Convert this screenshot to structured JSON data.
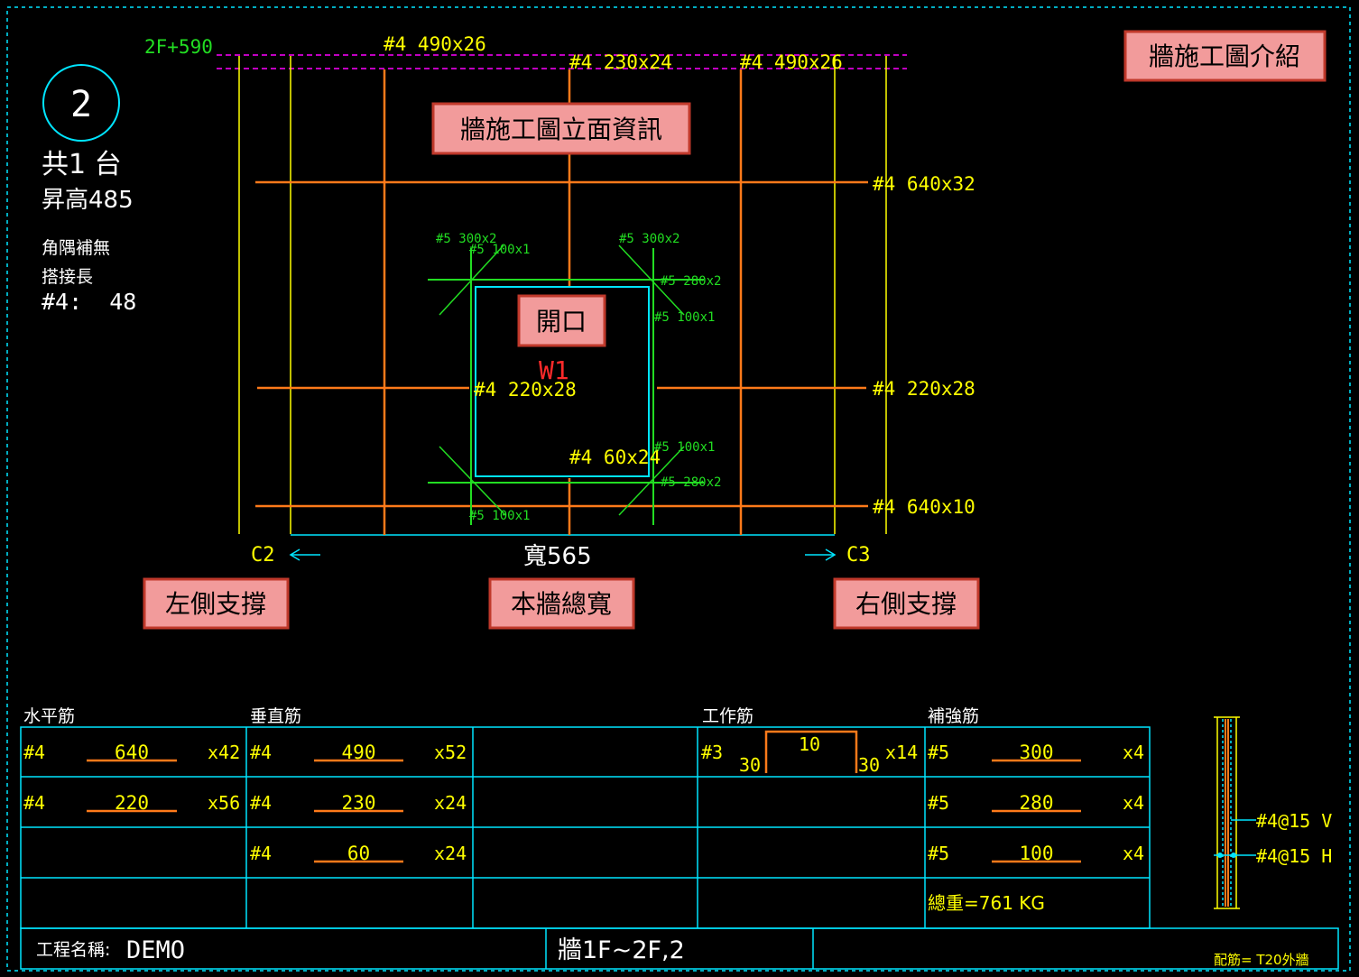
{
  "colors": {
    "background": "#000000",
    "cyan": "#00e5ff",
    "yellow": "#ffff00",
    "orange": "#ff7a1a",
    "green": "#22dd22",
    "magenta": "#ff00ff",
    "red": "#ff2a2a",
    "callout_fill": "#f29b9b",
    "callout_border": "#c0392b"
  },
  "header": {
    "wall_number": "2",
    "count_label": "共1 台",
    "height_label": "昇高485",
    "corner_label": "角隅補無",
    "lap_label": "搭接長",
    "lap_value": "#4:  48"
  },
  "elevation": {
    "level_label": "2F+590",
    "top_bars": [
      "#4 490x26",
      "#4 230x24",
      "#4 490x26"
    ],
    "right_bars": [
      "#4 640x32",
      "#4 220x28",
      "#4 640x10"
    ],
    "inner_bar_mid": "#4 220x28",
    "inner_bar_low": "#4 60x24",
    "opening_name": "W1",
    "reinforcement": {
      "tl_a": "#5 300x2",
      "tl_b": "#5 100x1",
      "tr_a": "#5 300x2",
      "tr_b": "#5 280x2",
      "tr_c": "#5 100x1",
      "br_a": "#5 100x1",
      "br_b": "#5 280x2",
      "bl_a": "#5 100x1"
    },
    "left_support": "C2",
    "right_support": "C3",
    "width_label": "寬565"
  },
  "callouts": {
    "intro": "牆施工圖介紹",
    "elevation_info": "牆施工圖立面資訊",
    "opening": "開口",
    "left_support": "左側支撐",
    "total_width": "本牆總寬",
    "right_support": "右側支撐"
  },
  "table": {
    "section_headers": [
      "水平筋",
      "垂直筋",
      "工作筋",
      "補強筋"
    ],
    "horizontal_rows": [
      {
        "bar": "#4",
        "length": "640",
        "qty": "x42"
      },
      {
        "bar": "#4",
        "length": "220",
        "qty": "x56"
      }
    ],
    "vertical_rows": [
      {
        "bar": "#4",
        "length": "490",
        "qty": "x52"
      },
      {
        "bar": "#4",
        "length": "230",
        "qty": "x24"
      },
      {
        "bar": "#4",
        "length": "60",
        "qty": "x24"
      }
    ],
    "work_bar": {
      "bar": "#3",
      "left": "30",
      "top": "10",
      "right": "30",
      "qty": "x14"
    },
    "reinforce_rows": [
      {
        "bar": "#5",
        "length": "300",
        "qty": "x4"
      },
      {
        "bar": "#5",
        "length": "280",
        "qty": "x4"
      },
      {
        "bar": "#5",
        "length": "100",
        "qty": "x4"
      }
    ],
    "total_weight": "總重=761 KG"
  },
  "section": {
    "v_label": "#4@15 V",
    "h_label": "#4@15 H"
  },
  "footer": {
    "project_label": "工程名稱:",
    "project_name": "DEMO",
    "wall_range": "牆1F~2F,2",
    "config_label": "配筋= T20外牆"
  }
}
